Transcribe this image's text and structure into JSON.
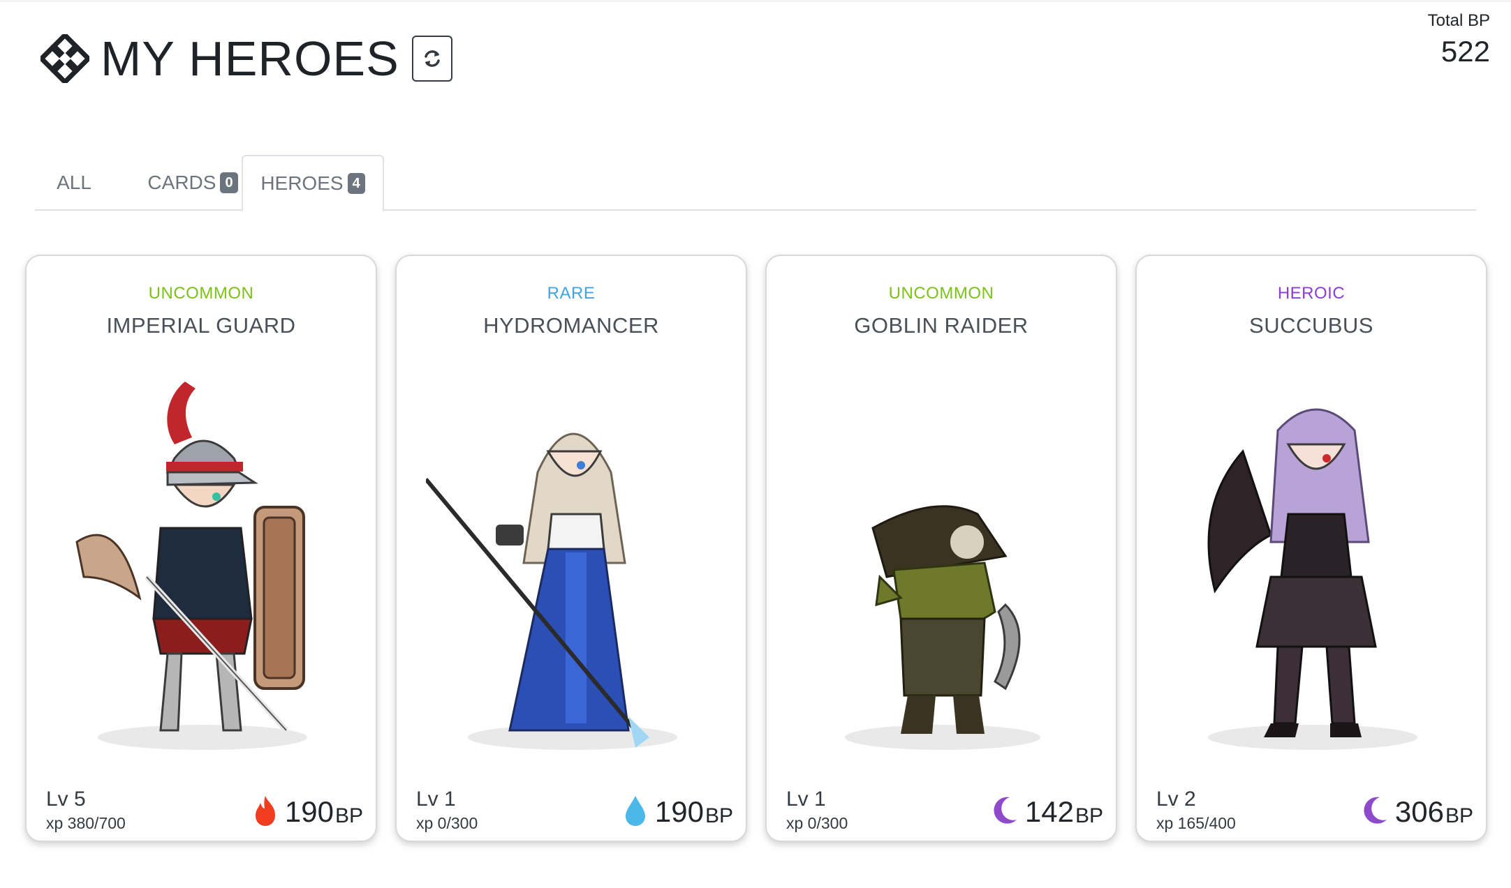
{
  "header": {
    "title": "MY HEROES",
    "logo_icon": "knot-logo-icon",
    "refresh_icon": "refresh-icon",
    "total_bp_label": "Total BP",
    "total_bp_value": "522"
  },
  "tabs": [
    {
      "label": "ALL",
      "badge": null,
      "active": false
    },
    {
      "label": "CARDS",
      "badge": "0",
      "active": false
    },
    {
      "label": "HEROES",
      "badge": "4",
      "active": true
    }
  ],
  "colors": {
    "uncommon": "#7cc21b",
    "rare": "#3fa3e6",
    "heroic": "#8e3cd6",
    "fire": "#f03d1f",
    "water": "#4cb8ea",
    "dark": "#8e4bc9"
  },
  "cards": [
    {
      "rarity": "UNCOMMON",
      "name": "IMPERIAL GUARD",
      "level": "Lv 5",
      "xp": "xp 380/700",
      "bp": "190",
      "bp_unit": "BP",
      "element": "fire-icon"
    },
    {
      "rarity": "RARE",
      "name": "HYDROMANCER",
      "level": "Lv 1",
      "xp": "xp 0/300",
      "bp": "190",
      "bp_unit": "BP",
      "element": "water-drop-icon"
    },
    {
      "rarity": "UNCOMMON",
      "name": "GOBLIN RAIDER",
      "level": "Lv 1",
      "xp": "xp 0/300",
      "bp": "142",
      "bp_unit": "BP",
      "element": "moon-icon"
    },
    {
      "rarity": "HEROIC",
      "name": "SUCCUBUS",
      "level": "Lv 2",
      "xp": "xp 165/400",
      "bp": "306",
      "bp_unit": "BP",
      "element": "moon-icon"
    }
  ]
}
